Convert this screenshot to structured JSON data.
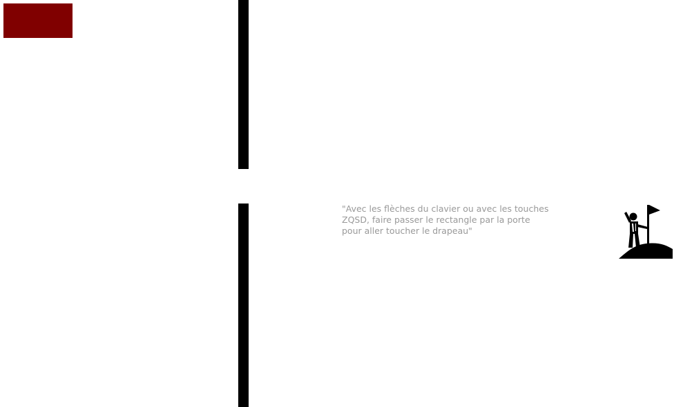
{
  "game": {
    "player": {
      "color": "#800000"
    },
    "walls": {
      "color": "#000000"
    },
    "instructions": "\"Avec les flèches du clavier ou avec les touches ZQSD, faire passer le rectangle par la porte pour aller toucher le drapeau\"",
    "goal": {
      "icon": "climber-with-flag-icon",
      "color": "#000000"
    }
  }
}
